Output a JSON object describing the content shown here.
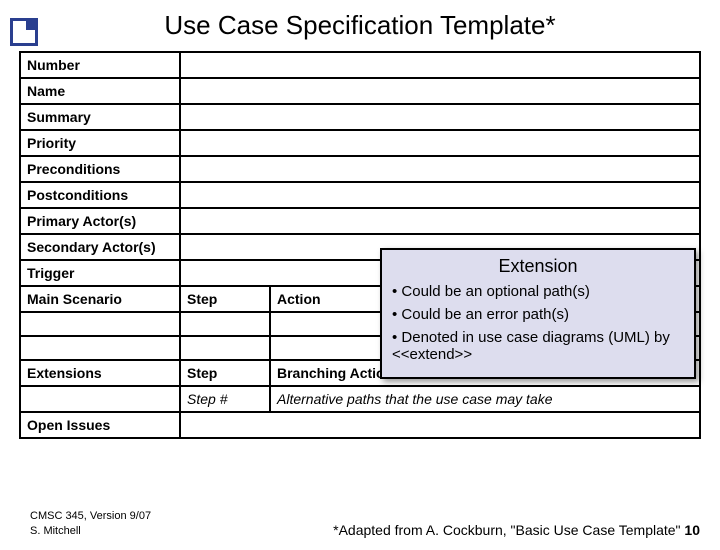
{
  "title": "Use Case Specification Template*",
  "rows": {
    "number": "Number",
    "name": "Name",
    "summary": "Summary",
    "priority": "Priority",
    "preconditions": "Preconditions",
    "postconditions": "Postconditions",
    "primary_actors": "Primary Actor(s)",
    "secondary_actors": "Secondary Actor(s)",
    "trigger": "Trigger",
    "main_scenario": "Main Scenario",
    "step": "Step",
    "action": "Action",
    "extensions": "Extensions",
    "branching_action": "Branching Action",
    "step_num": "Step #",
    "alt_paths": "Alternative paths that the use case may take",
    "open_issues": "Open Issues"
  },
  "callout": {
    "heading": "Extension",
    "b1": "• Could be an optional path(s)",
    "b2": "• Could be an error path(s)",
    "b3": "• Denoted in use case diagrams (UML) by <<extend>>"
  },
  "footer": {
    "course": "CMSC 345, Version 9/07",
    "author": "S. Mitchell",
    "citation": "*Adapted from A. Cockburn, \"Basic Use Case Template\"",
    "page": "10"
  }
}
